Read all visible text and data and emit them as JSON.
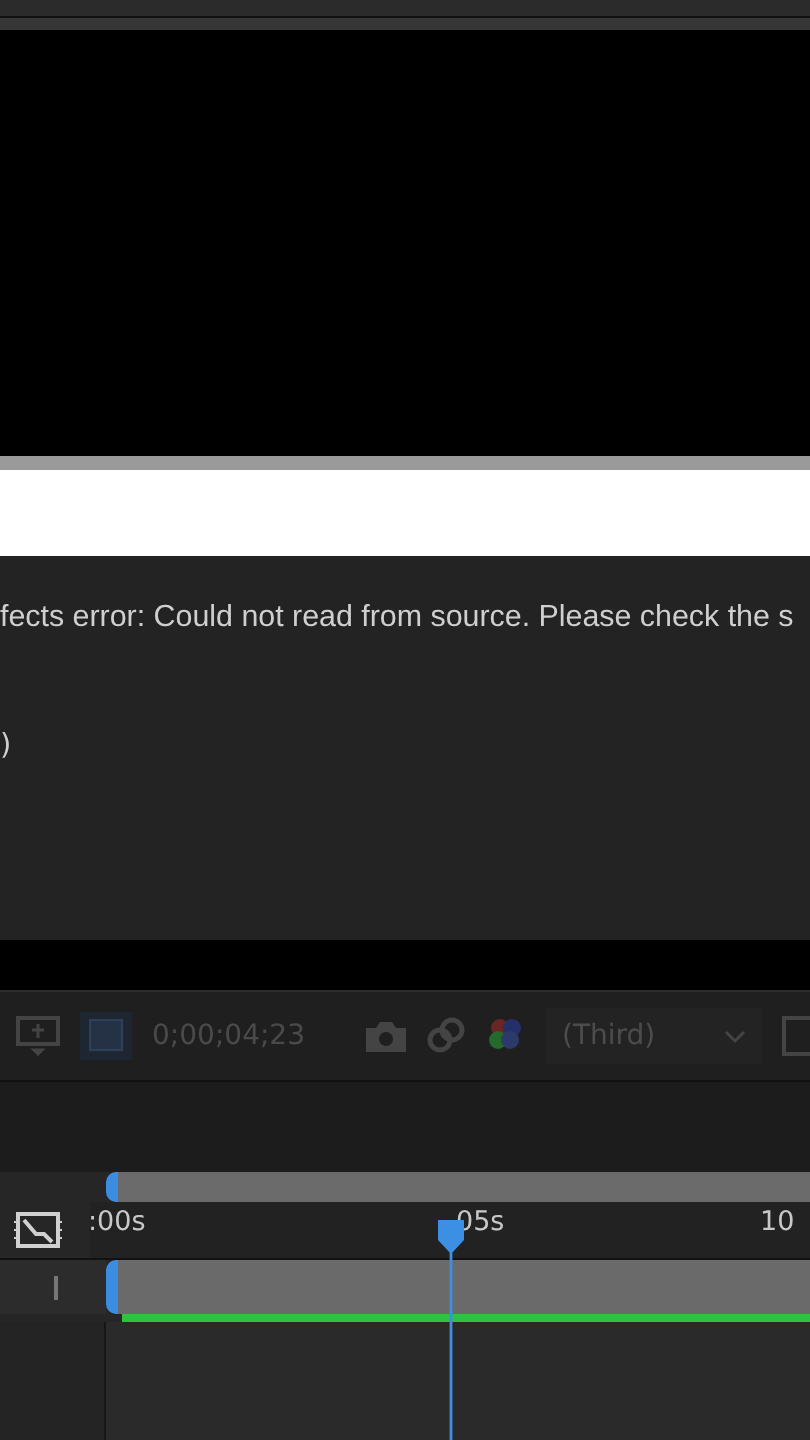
{
  "error_panel": {
    "message": "fects error: Could not read from source. Please check the s",
    "line_2": ")"
  },
  "toolbar": {
    "timecode": "0;00;04;23",
    "resolution": "(Third)"
  },
  "timeline": {
    "ruler_labels": [
      ":00s",
      "05s",
      "10"
    ]
  }
}
